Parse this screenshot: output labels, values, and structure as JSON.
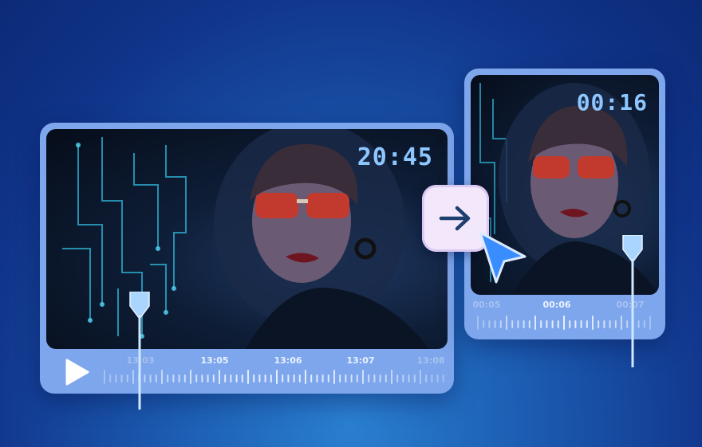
{
  "left_player": {
    "timecode": "20:45",
    "timeline_labels": [
      "13:03",
      "13:05",
      "13:06",
      "13:07",
      "13:08"
    ],
    "icons": {
      "play": "play-icon"
    }
  },
  "right_player": {
    "timecode": "00:16",
    "timeline_labels": [
      "00:05",
      "00:06",
      "00:07"
    ]
  },
  "actions": {
    "convert": "arrow-right-icon",
    "pointer": "cursor-arrow-icon"
  },
  "colors": {
    "background": "#10348a",
    "panel": "#7ea6ec",
    "timecode": "#8ec7ff",
    "arrow_button": "#f3e8fb",
    "cursor": "#3a8dff"
  }
}
